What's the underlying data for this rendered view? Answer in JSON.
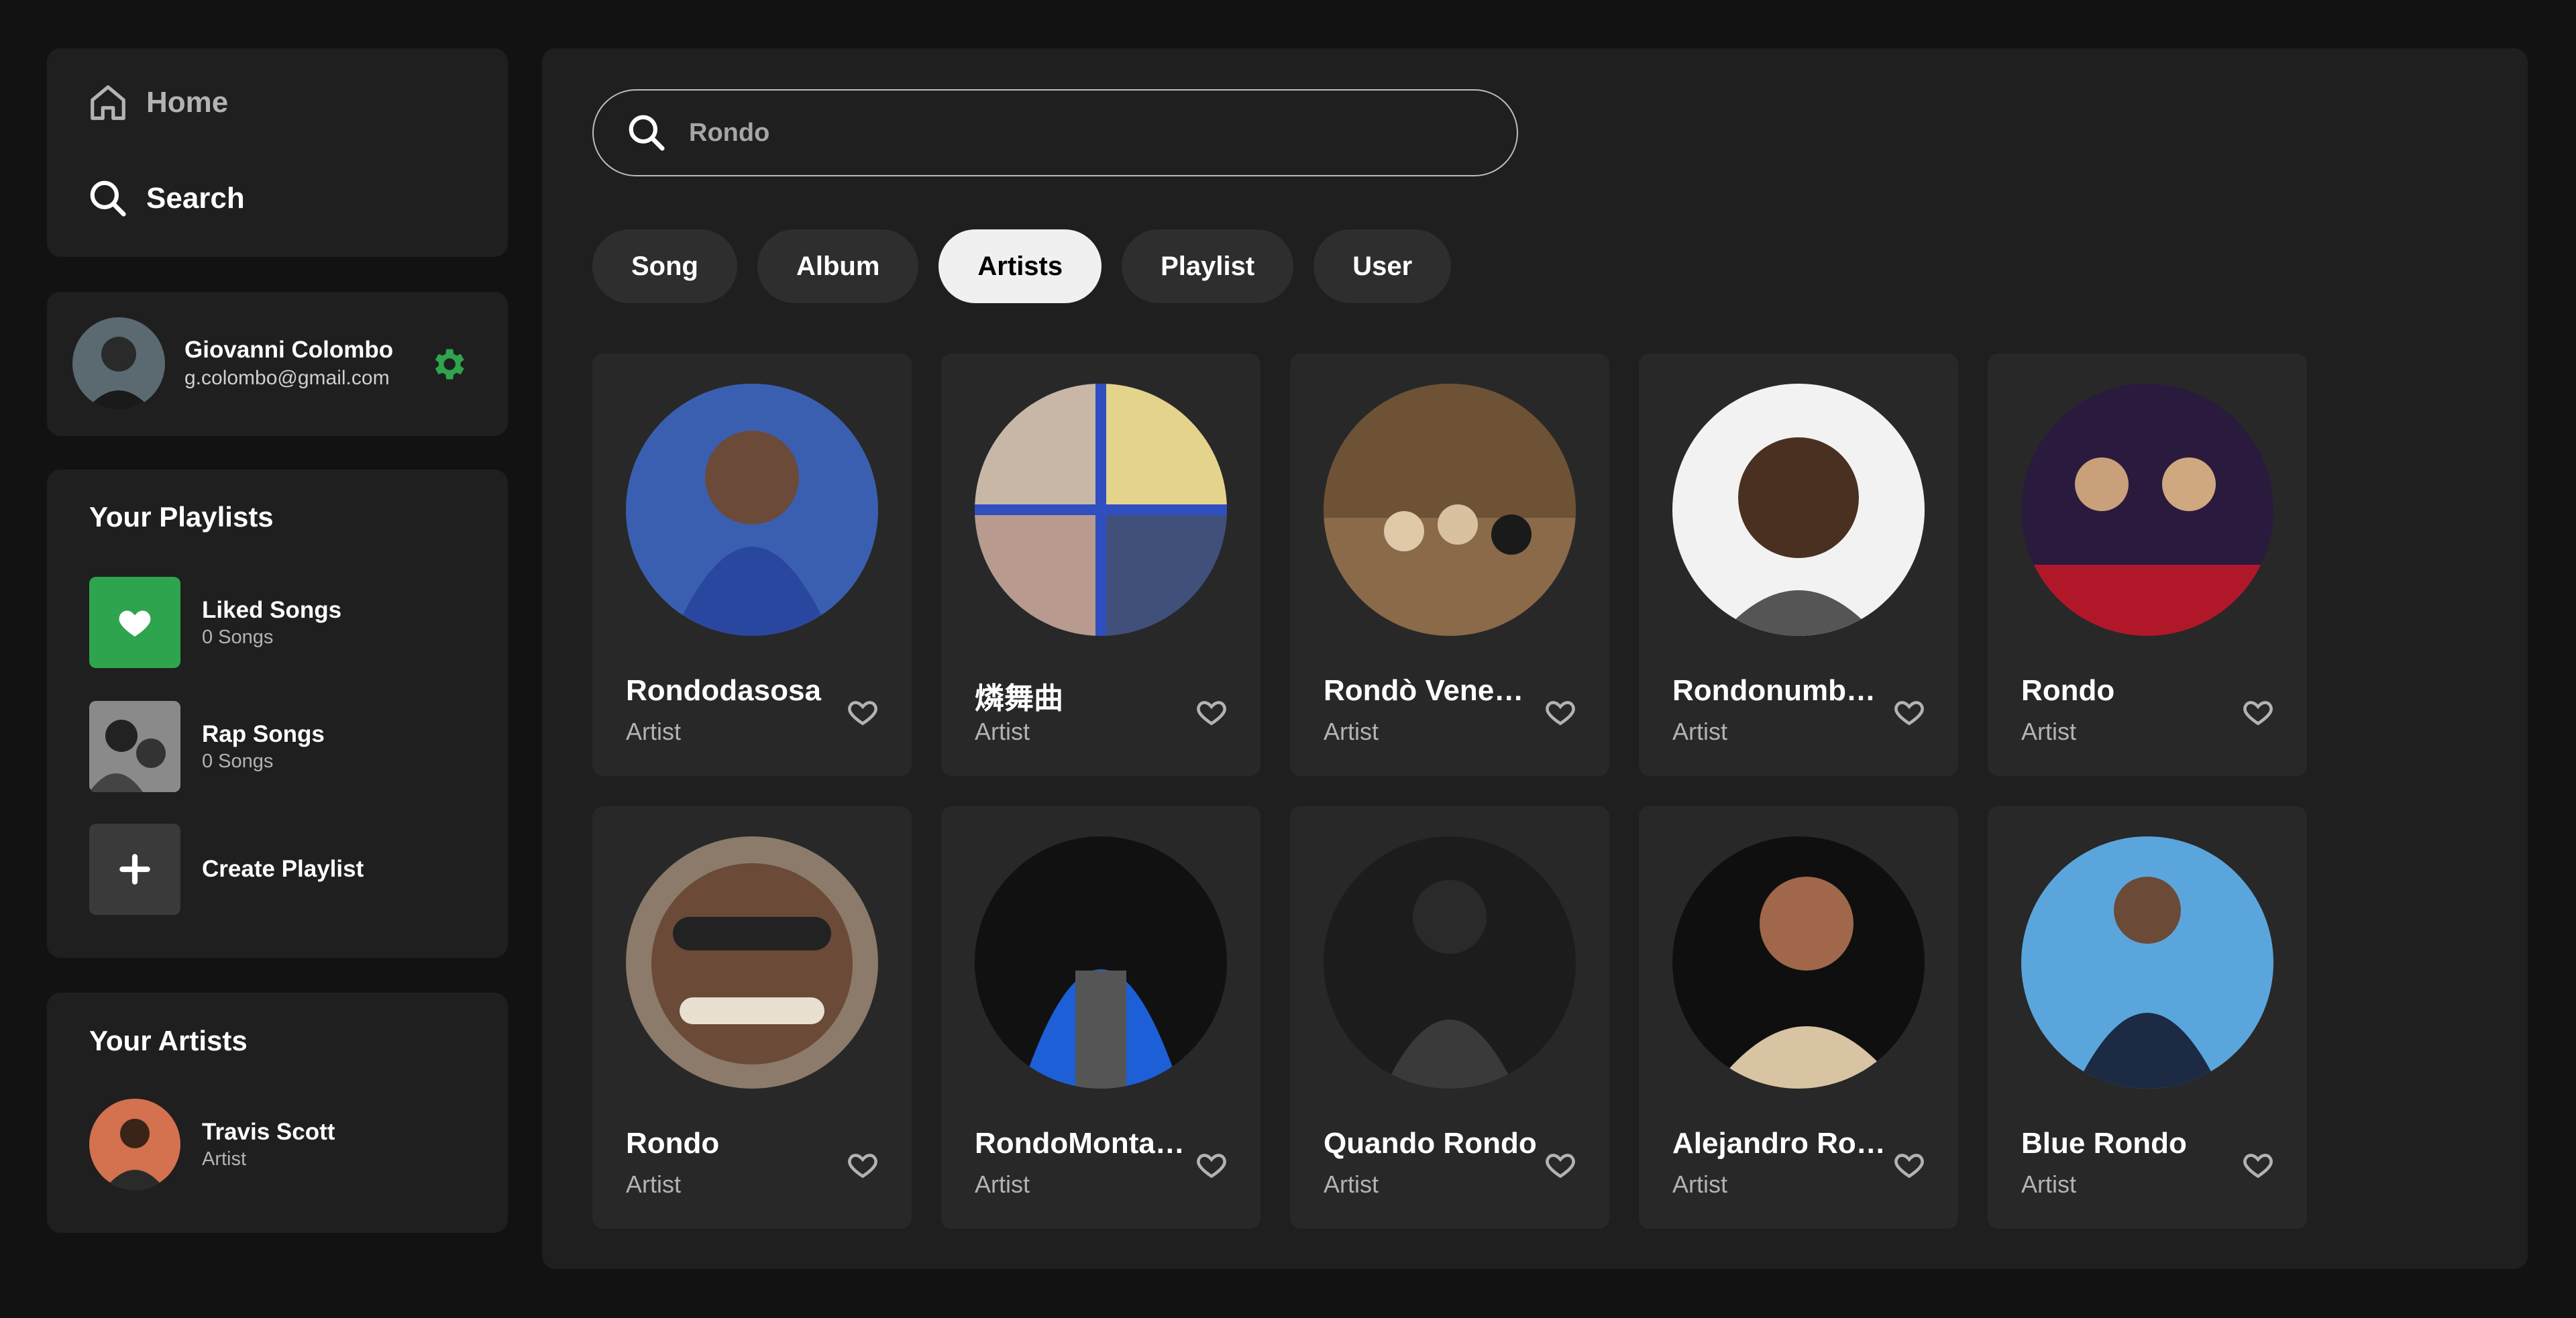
{
  "nav": {
    "home_label": "Home",
    "search_label": "Search"
  },
  "profile": {
    "name": "Giovanni Colombo",
    "email": "g.colombo@gmail.com"
  },
  "playlists": {
    "title": "Your Playlists",
    "items": [
      {
        "name": "Liked Songs",
        "sub": "0 Songs",
        "icon": "heart-icon"
      },
      {
        "name": "Rap Songs",
        "sub": "0 Songs",
        "icon": "cover-image"
      },
      {
        "name": "Create Playlist",
        "icon": "plus-icon"
      }
    ]
  },
  "your_artists": {
    "title": "Your Artists",
    "items": [
      {
        "name": "Travis Scott",
        "type": "Artist"
      }
    ]
  },
  "search": {
    "value": "Rondo"
  },
  "filters": [
    {
      "label": "Song",
      "active": false
    },
    {
      "label": "Album",
      "active": false
    },
    {
      "label": "Artists",
      "active": true
    },
    {
      "label": "Playlist",
      "active": false
    },
    {
      "label": "User",
      "active": false
    }
  ],
  "results": [
    {
      "name": "Rondodasosa",
      "type": "Artist"
    },
    {
      "name": "燐舞曲",
      "type": "Artist"
    },
    {
      "name": "Rondò Veneziano",
      "type": "Artist"
    },
    {
      "name": "Rondonumbanine",
      "type": "Artist"
    },
    {
      "name": "Rondo",
      "type": "Artist"
    },
    {
      "name": "Rondo",
      "type": "Artist"
    },
    {
      "name": "RondoMontana",
      "type": "Artist"
    },
    {
      "name": "Quando Rondo",
      "type": "Artist"
    },
    {
      "name": "Alejandro Rondón",
      "type": "Artist"
    },
    {
      "name": "Blue Rondo",
      "type": "Artist"
    }
  ],
  "colors": {
    "accent_green": "#2ea44f",
    "chip_active_bg": "#f0f0f0",
    "card_bg": "#282828",
    "panel_bg": "#1f1f1f"
  }
}
